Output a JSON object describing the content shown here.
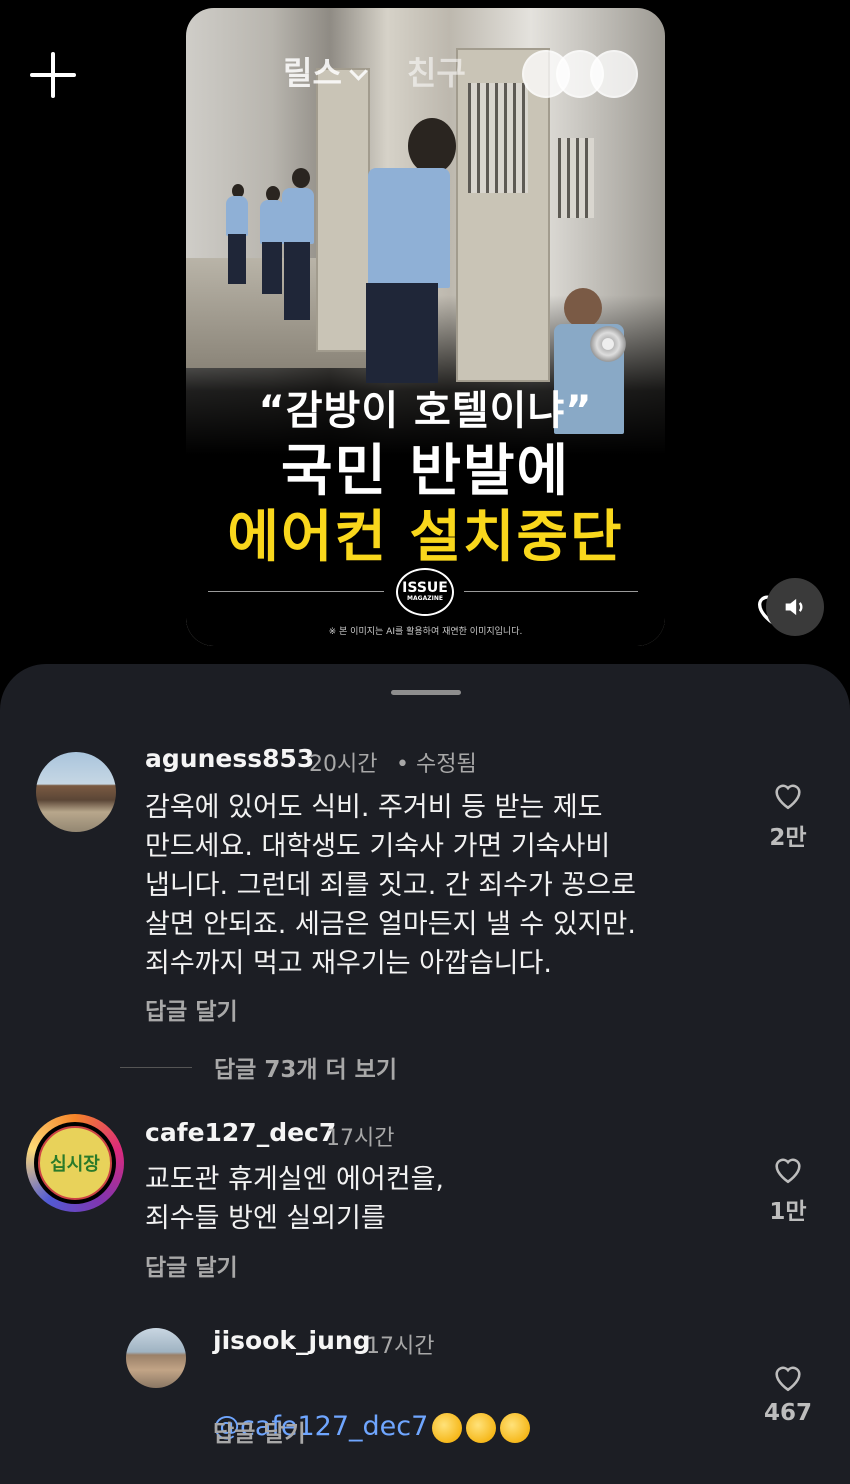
{
  "reel": {
    "tabs": [
      {
        "label": "릴스"
      },
      {
        "label": "친구"
      }
    ],
    "headline_line1": "“감방이 호텔이냐”",
    "headline_line2": "국민 반발에",
    "headline_line3": "에어컨 설치중단",
    "badge_line1": "ISSUE",
    "badge_line2": "MAGAZINE",
    "disclaimer": "※ 본 이미지는 AI를 활용하여 재연한 이미지입니다.",
    "accent_color": "#f9d71c"
  },
  "comments": [
    {
      "username": "aguness853",
      "time": "20시간",
      "edited": "• 수정됨",
      "text": "감옥에 있어도  식비. 주거비 등 받는 제도\n만드세요. 대학생도 기숙사 가면 기숙사비\n냅니다.  그런데 죄를 짓고. 간 죄수가 꽁으로\n살면 안되죠.  세금은 얼마든지 낼 수 있지만.\n죄수까지 먹고 재우기는 아깝습니다.",
      "reply_label": "답글 달기",
      "likes": "2만",
      "more_replies": "답글 73개 더 보기"
    },
    {
      "username": "cafe127_dec7",
      "time": "17시간",
      "text": "교도관 휴게실엔 에어컨을,\n죄수들 방엔 실외기를",
      "reply_label": "답글 달기",
      "likes": "1만",
      "avatar_text": "십시장"
    },
    {
      "username": "jisook_jung",
      "time": "17시간",
      "mention": "@cafe127_dec7",
      "reply_label": "답글 달기",
      "likes": "467"
    }
  ]
}
